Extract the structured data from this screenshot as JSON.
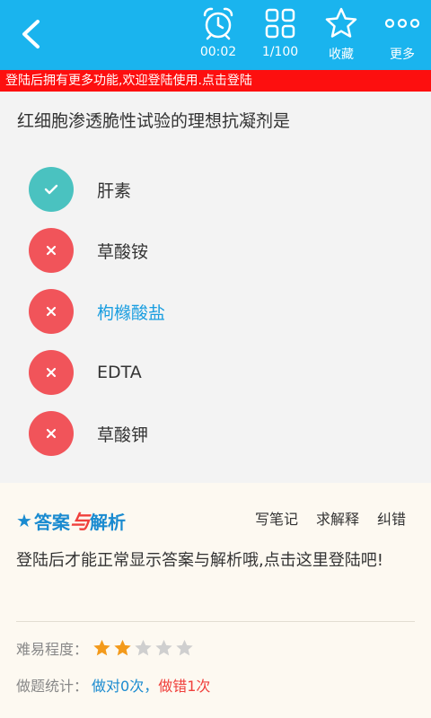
{
  "toolbar": {
    "timer": "00:02",
    "progress": "1/100",
    "favorite": "收藏",
    "more": "更多"
  },
  "banner": {
    "text": "登陆后拥有更多功能,欢迎登陆使用.点击登陆"
  },
  "question": {
    "text": "红细胞渗透脆性试验的理想抗凝剂是",
    "options": [
      {
        "label": "肝素",
        "state": "correct"
      },
      {
        "label": "草酸铵",
        "state": "wrong"
      },
      {
        "label": "枸橼酸盐",
        "state": "selected"
      },
      {
        "label": "EDTA",
        "state": "wrong"
      },
      {
        "label": "草酸钾",
        "state": "wrong"
      }
    ]
  },
  "answer": {
    "title_1": "答案",
    "title_2": "与",
    "title_3": "解析",
    "actions": {
      "note": "写笔记",
      "explain": "求解释",
      "correct": "纠错"
    },
    "login_msg": "登陆后才能正常显示答案与解析哦,点击这里登陆吧!",
    "difficulty_label": "难易程度：",
    "difficulty_stars": 2,
    "difficulty_max": 5,
    "stats_label": "做题统计：",
    "stats_right": "做对0次，",
    "stats_wrong": "做错1次"
  },
  "colors": {
    "topbar": "#1ab4ee",
    "banner": "#fd0f0f",
    "correct": "#4ac2c0",
    "wrong": "#f1545a",
    "selected_text": "#1a9ee0",
    "star_on": "#f39a1b",
    "star_off": "#cfcfcf"
  }
}
